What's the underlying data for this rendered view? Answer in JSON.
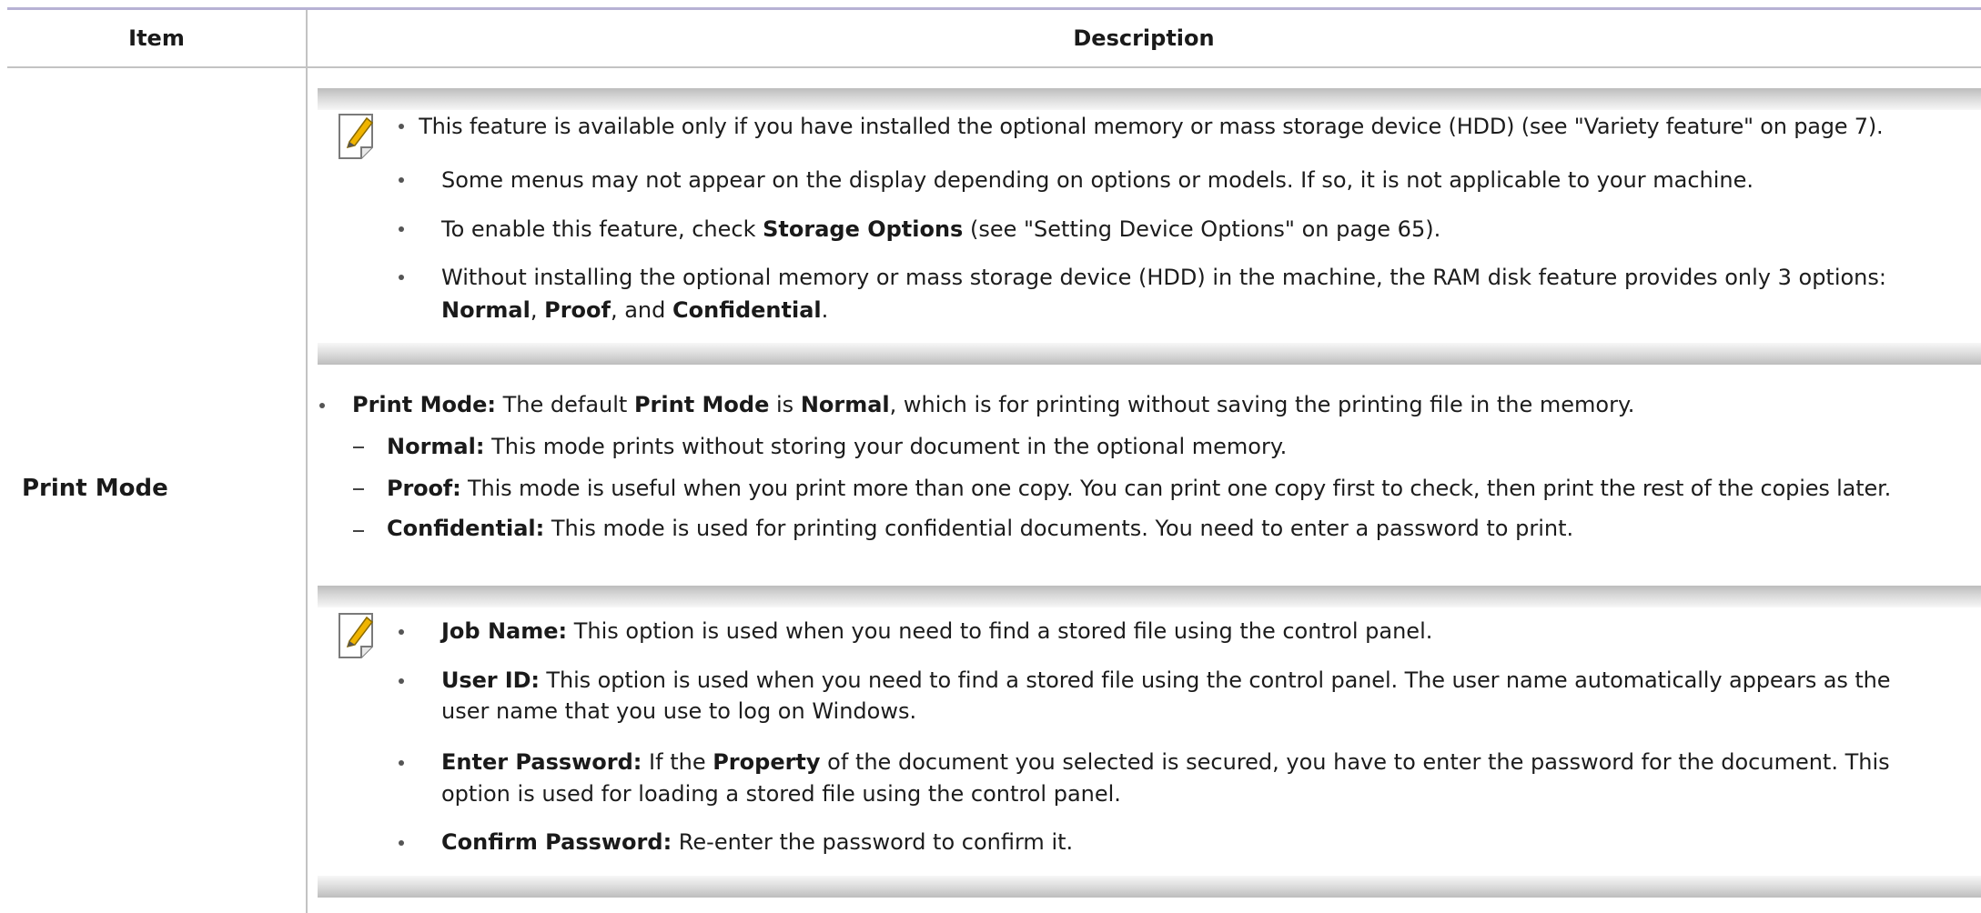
{
  "table": {
    "headers": {
      "item": "Item",
      "description": "Description"
    },
    "row": {
      "item": "Print Mode",
      "note1": {
        "bullets": [
          [
            "This feature is available only if you have installed the optional memory or mass storage device (HDD) (see \"Variety feature\" on page 7)."
          ],
          [
            "Some menus may not appear on the display depending on options or models. If so, it is not applicable to your machine."
          ],
          [
            "To enable this feature, check ",
            "Storage Options",
            " (see \"Setting Device Options\" on page 65)."
          ],
          [
            "Without installing the optional memory or mass storage device (HDD) in the machine, the RAM disk feature provides only 3 options:"
          ],
          [
            "Normal",
            ", ",
            "Proof",
            ", and ",
            "Confidential",
            "."
          ]
        ]
      },
      "main": {
        "intro": [
          "Print Mode:",
          " The default ",
          "Print Mode",
          " is ",
          "Normal",
          ", which is for printing without saving the printing file in the memory."
        ],
        "options": [
          [
            "Normal:",
            " This mode prints without storing your document in the optional memory."
          ],
          [
            "Proof:",
            " This mode is useful when you print more than one copy. You can print one copy first to check, then print the rest of the copies later."
          ],
          [
            "Confidential:",
            " This mode is used for printing confidential documents. You need to enter a password to print."
          ]
        ]
      },
      "note2": {
        "bullets": [
          [
            "Job Name:",
            " This option is used when you need to find a stored file using the control panel."
          ],
          [
            "User ID:",
            " This option is used when you need to find a stored file using the control panel. The user name automatically appears as the"
          ],
          [
            "user name that you use to log on Windows."
          ],
          [
            "Enter Password:",
            " If the ",
            "Property",
            " of the document you selected is secured, you have to enter the password for the document.  This"
          ],
          [
            "option is used for loading a stored file using the control panel."
          ],
          [
            "Confirm Password:",
            " Re-enter the password to confirm it."
          ]
        ]
      }
    }
  },
  "icons": {
    "note": "note-pencil-icon"
  },
  "colors": {
    "top_rule": "#b7b2d4",
    "grid": "#c3c3c3",
    "pencil": "#f0b400"
  }
}
